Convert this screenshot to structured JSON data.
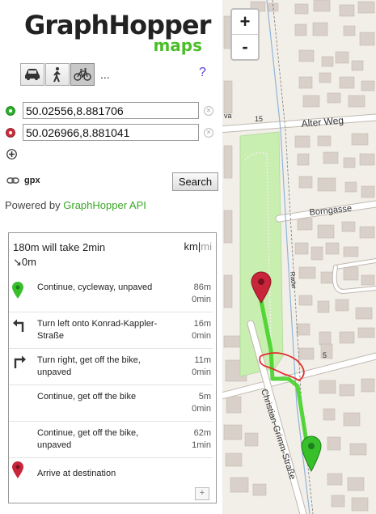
{
  "logo": {
    "main": "GraphHopper",
    "sub": "maps"
  },
  "vehicles": {
    "modes": [
      "car-icon",
      "foot-icon",
      "bike-icon"
    ],
    "active": "bike",
    "more_label": "...",
    "help_label": "?"
  },
  "points": {
    "from": {
      "value": "50.02556,8.881706",
      "color": "#2cb02c"
    },
    "to": {
      "value": "50.026966,8.881041",
      "color": "#cc2d3c"
    }
  },
  "export": {
    "label": "gpx"
  },
  "search_button": "Search",
  "powered": {
    "prefix": "Powered by ",
    "link": "GraphHopper API"
  },
  "summary": {
    "text": "180m will take 2min",
    "ascend": "↘0m",
    "unit_km": "km",
    "unit_sep": "|",
    "unit_mi": "mi"
  },
  "instructions": [
    {
      "icon": "green-marker-icon",
      "text": "Continue, cycleway, unpaved",
      "distance": "86m",
      "time": "0min"
    },
    {
      "icon": "turn-left-icon",
      "text": "Turn left onto Konrad-Kappler-Straße",
      "distance": "16m",
      "time": "0min"
    },
    {
      "icon": "turn-right-icon",
      "text": "Turn right, get off the bike, unpaved",
      "distance": "11m",
      "time": "0min"
    },
    {
      "icon": "",
      "text": "Continue, get off the bike",
      "distance": "5m",
      "time": "0min"
    },
    {
      "icon": "",
      "text": "Continue, get off the bike, unpaved",
      "distance": "62m",
      "time": "1min"
    },
    {
      "icon": "red-marker-icon",
      "text": "Arrive at destination",
      "distance": "",
      "time": ""
    }
  ],
  "expand_label": "+",
  "map": {
    "zoom_in": "+",
    "zoom_out": "-",
    "streets": {
      "alter_weg": "Alter Weg",
      "borngasse": "Borngasse",
      "christian_grimm": "Christian-Grimm-Straße",
      "radw": "Radw",
      "va": "va"
    },
    "house_numbers": {
      "n15": "15",
      "n5": "5"
    },
    "route_color": "#46d22a"
  }
}
